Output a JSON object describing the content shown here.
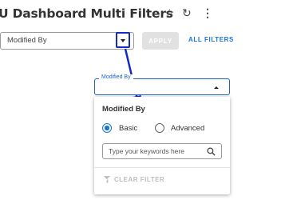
{
  "header": {
    "title": "U Dashboard Multi Filters",
    "star_icon": "☆",
    "refresh_icon": "↻",
    "more_icon": "⋮"
  },
  "toolbar": {
    "filter_select_value": "Modified By",
    "apply_label": "APPLY",
    "all_filters_label": "ALL FILTERS"
  },
  "dropdown": {
    "field_legend": "Modified By",
    "panel_title": "Modified By",
    "radio_basic": "Basic",
    "radio_advanced": "Advanced",
    "selected_mode": "Basic",
    "search_placeholder": "Type your keywords here",
    "clear_filter_label": "CLEAR FILTER"
  },
  "colors": {
    "accent": "#1a73d8",
    "annotation": "#1628c8",
    "disabled": "#bdbdbd"
  }
}
